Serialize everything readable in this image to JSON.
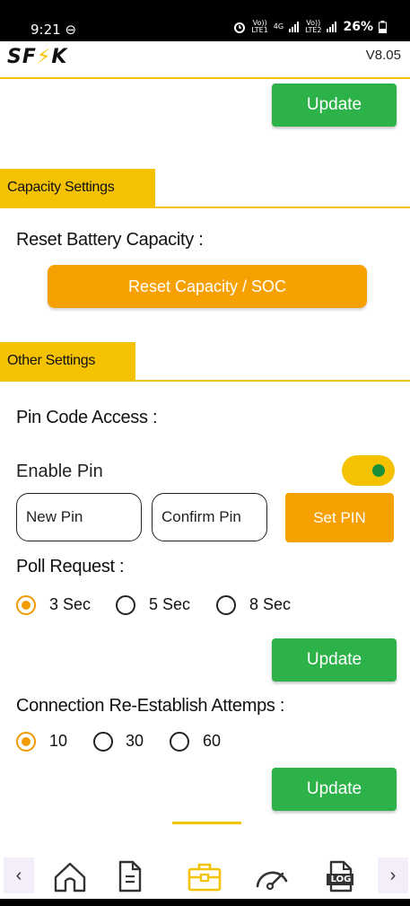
{
  "status_bar": {
    "time": "9:21",
    "dnd_icon": "⊖",
    "network_label_1_top": "Vo))",
    "network_label_1_bottom": "LTE1",
    "network_type": "4G",
    "network_label_2_top": "Vo))",
    "network_label_2_bottom": "LTE2",
    "battery": "26%"
  },
  "header": {
    "logo": "SF⚡K",
    "version": "V8.05"
  },
  "top_update_label": "Update",
  "capacity_settings": {
    "section_title": "Capacity Settings",
    "heading": "Reset Battery Capacity :",
    "reset_button": "Reset Capacity / SOC"
  },
  "other_settings": {
    "section_title": "Other Settings",
    "pin_heading": "Pin Code Access :",
    "enable_pin_label": "Enable Pin",
    "new_pin_placeholder": "New Pin",
    "confirm_pin_placeholder": "Confirm Pin",
    "set_pin_button": "Set PIN",
    "poll_heading": "Poll Request :",
    "poll_options": [
      "3 Sec",
      "5 Sec",
      "8 Sec"
    ],
    "poll_update": "Update",
    "connection_heading": "Connection Re-Establish Attemps :",
    "connection_options": [
      "10",
      "30",
      "60"
    ],
    "connection_update": "Update"
  },
  "bottom_nav": {
    "prev": "‹",
    "next": "›",
    "log_label": "LOG"
  },
  "colors": {
    "accent_yellow": "#f4c200",
    "button_green": "#2db24a",
    "button_orange": "#f7a100",
    "toggle_knob": "#1a8f3a"
  }
}
